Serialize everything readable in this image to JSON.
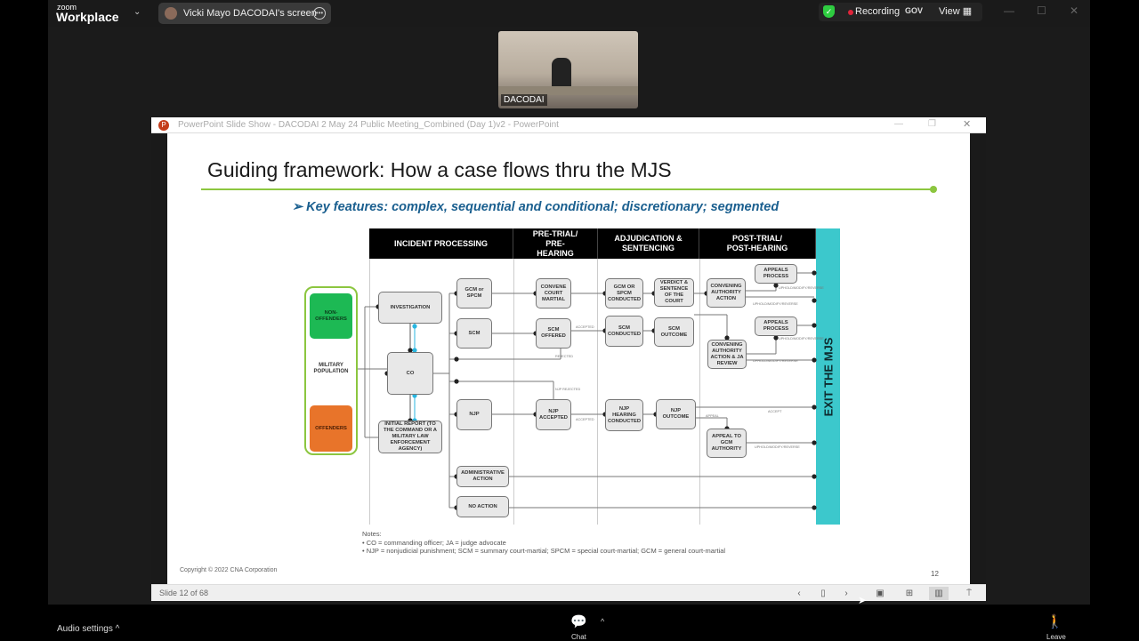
{
  "zoom": {
    "brand_small": "zoom",
    "brand": "Workplace",
    "share_label": "Vicki Mayo DACODAI's screen",
    "recording": "Recording",
    "gov": "GOV",
    "view": "View",
    "video_name": "DACODAI"
  },
  "ppt": {
    "title": "PowerPoint Slide Show  -  DACODAI 2 May 24 Public Meeting_Combined (Day 1)v2 - PowerPoint",
    "status": "Slide 12 of 68"
  },
  "slide": {
    "title": "Guiding framework: How a case flows thru the MJS",
    "subtitle": "➢ Key features: complex, sequential and conditional; discretionary; segmented",
    "columns": [
      "INCIDENT PROCESSING",
      "PRE-TRIAL/ PRE-HEARING",
      "ADJUDICATION & SENTENCING",
      "POST-TRIAL/ POST-HEARING"
    ],
    "exit": "EXIT THE MJS",
    "population": {
      "non_offenders": "NON-OFFENDERS",
      "military": "MILITARY POPULATION",
      "offenders": "OFFENDERS"
    },
    "boxes": {
      "investigation": "INVESTIGATION",
      "co": "CO",
      "initial_report": "INITIAL REPORT (TO THE COMMAND OR A MILITARY LAW ENFORCEMENT AGENCY)",
      "gcm_spcm": "GCM or SPCM",
      "scm": "SCM",
      "njp": "NJP",
      "admin": "ADMINISTRATIVE ACTION",
      "no_action": "NO ACTION",
      "convene": "CONVENE COURT MARTIAL",
      "scm_offered": "SCM OFFERED",
      "njp_accepted": "NJP ACCEPTED",
      "gcm_conducted": "GCM OR SPCM CONDUCTED",
      "scm_conducted": "SCM CONDUCTED",
      "njp_hearing": "NJP HEARING CONDUCTED",
      "verdict": "VERDICT & SENTENCE OF THE COURT",
      "scm_outcome": "SCM OUTCOME",
      "njp_outcome": "NJP OUTCOME",
      "ca_action": "CONVENING AUTHORITY ACTION",
      "ca_ja": "CONVENING AUTHORITY ACTION & JA REVIEW",
      "appeal_gcm": "APPEAL TO GCM AUTHORITY",
      "appeals1": "APPEALS PROCESS",
      "appeals2": "APPEALS PROCESS"
    },
    "edge_labels": {
      "accepted": "ACCEPTED",
      "rejected": "REJECTED",
      "njp_rejected": "NJP REJECTED",
      "uphold": "UPHOLD/MODIFY/REVERSE",
      "appeal": "APPEAL",
      "accept": "ACCEPT"
    },
    "notes_title": "Notes:",
    "notes": [
      "• CO = commanding officer; JA = judge advocate",
      "• NJP = nonjudicial punishment; SCM = summary court-martial; SPCM = special court-martial; GCM = general court-martial"
    ],
    "copyright": "Copyright © 2022 CNA Corporation",
    "page": "12"
  },
  "footer": {
    "audio": "Audio settings ^",
    "chat": "Chat",
    "leave": "Leave"
  },
  "colors": {
    "accent_green": "#8cc63f",
    "exit_teal": "#3cc8cc",
    "non_offenders": "#1db954",
    "offenders": "#e8742a",
    "recording": "#e0243a"
  }
}
